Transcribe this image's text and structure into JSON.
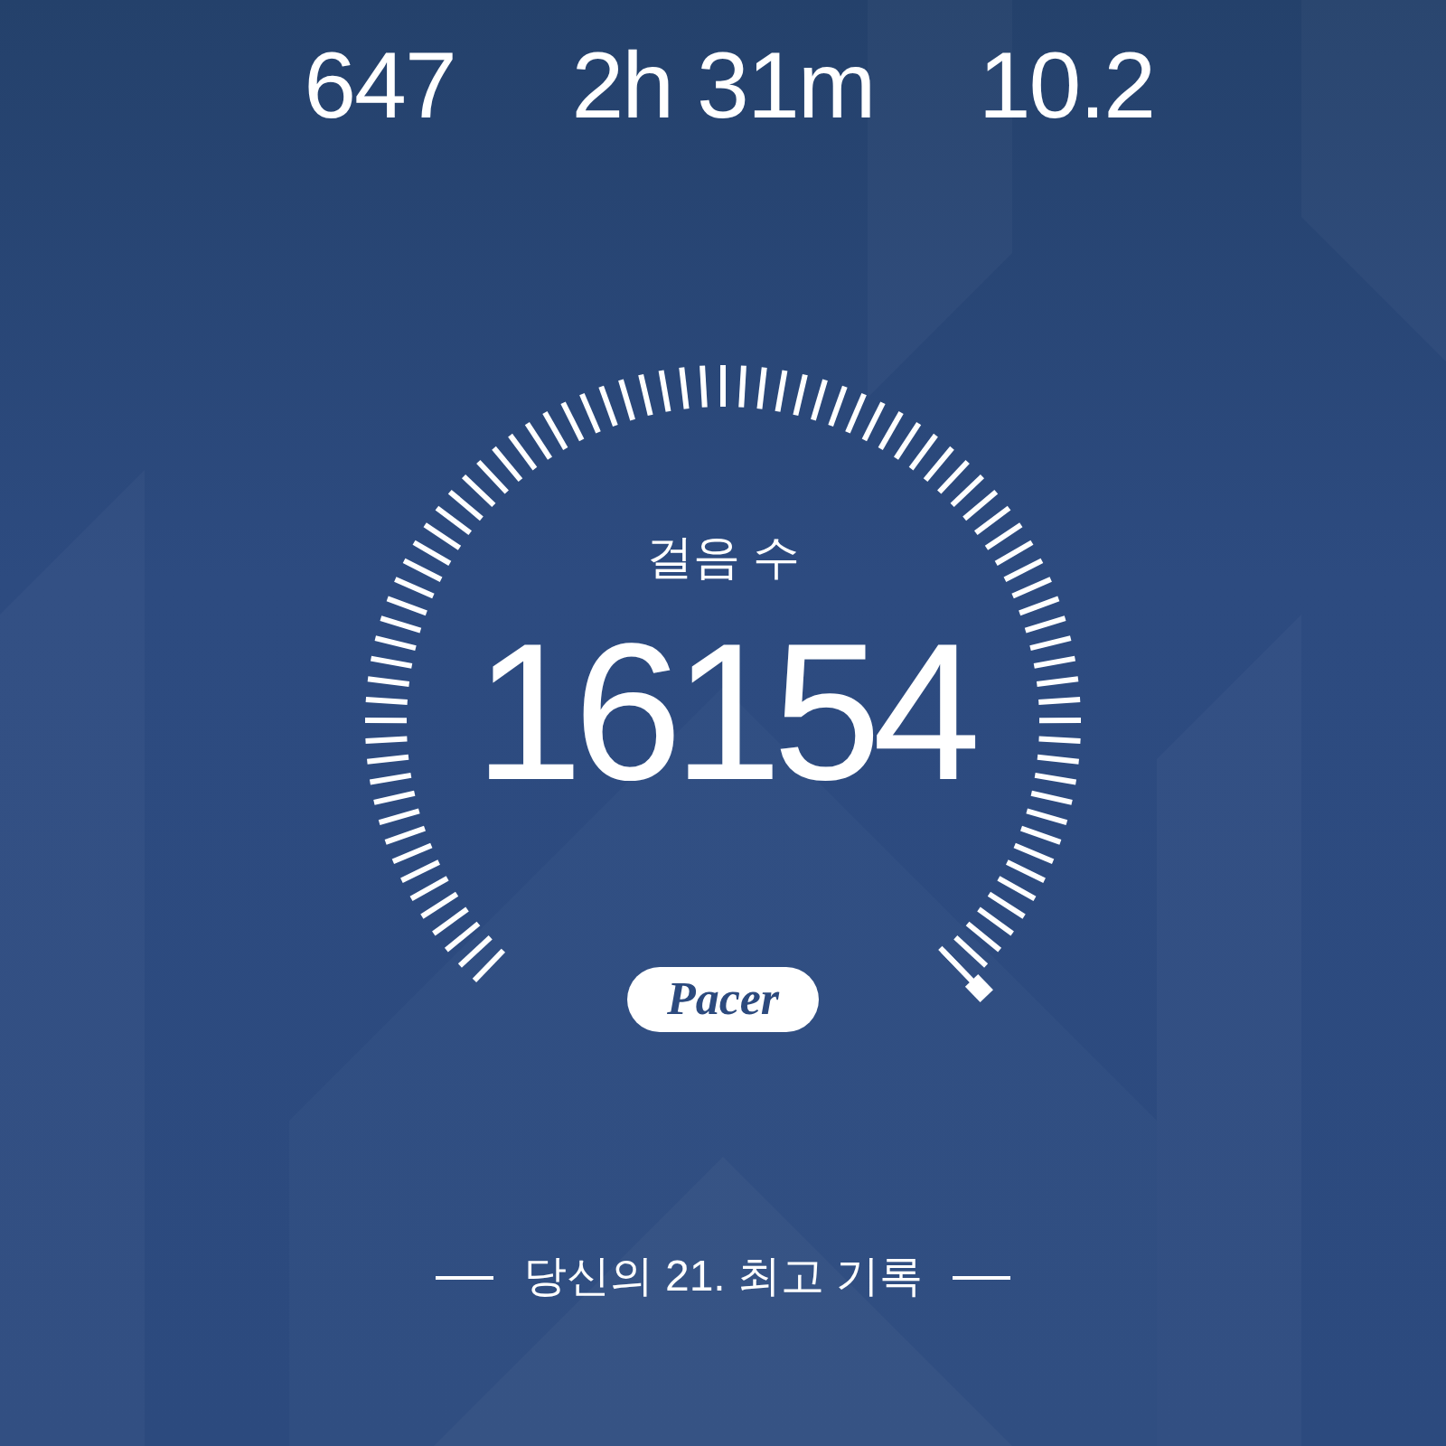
{
  "stats": [
    {
      "value": "647"
    },
    {
      "value": "2h 31m"
    },
    {
      "value": "10.2"
    }
  ],
  "gauge": {
    "label": "걸음 수",
    "value": "16154"
  },
  "logo": {
    "text": "Pacer"
  },
  "footer": {
    "text": "당신의 21. 최고 기록"
  }
}
